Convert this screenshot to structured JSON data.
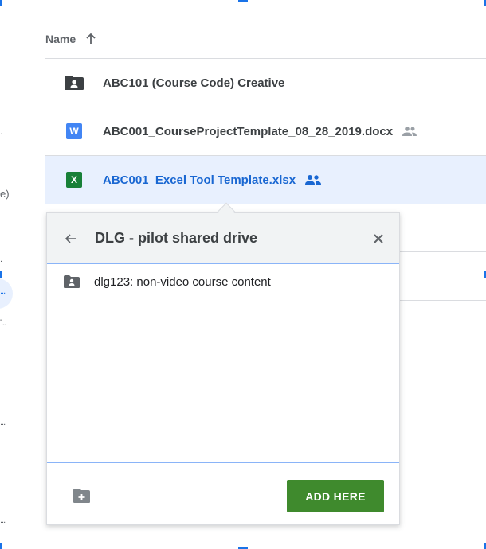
{
  "list": {
    "header": {
      "name_label": "Name",
      "sort_icon": "arrow-up-icon"
    },
    "rows": [
      {
        "name": "ABC101 (Course Code) Creative",
        "icon": "shared-drive-folder-icon",
        "shared": false,
        "selected": false
      },
      {
        "name": "ABC001_CourseProjectTemplate_08_28_2019.docx",
        "icon": "word-doc-icon",
        "badge": "W",
        "shared": true,
        "selected": false
      },
      {
        "name": "ABC001_Excel Tool Template.xlsx",
        "icon": "excel-sheet-icon",
        "badge": "X",
        "shared": true,
        "selected": true
      }
    ]
  },
  "sidebar": {
    "fragments": [
      "e)"
    ]
  },
  "popup": {
    "title": "DLG - pilot shared drive",
    "back_icon": "back-arrow-icon",
    "close_icon": "close-icon",
    "items": [
      {
        "label": "dlg123: non-video course content",
        "icon": "shared-drive-folder-icon"
      }
    ],
    "new_folder_icon": "new-folder-icon",
    "add_button": "ADD HERE"
  },
  "colors": {
    "accent": "#1a73e8",
    "selected_bg": "#e8f0fe",
    "add_button": "#3f8a2d",
    "word": "#4285f4",
    "excel": "#188038"
  }
}
